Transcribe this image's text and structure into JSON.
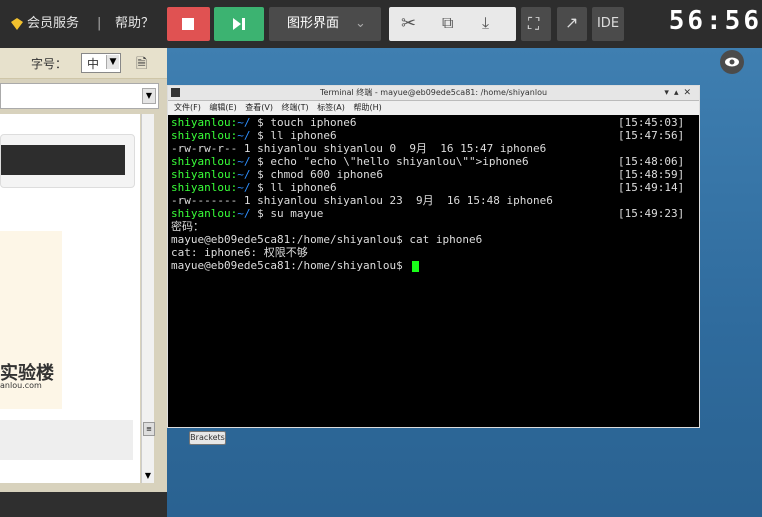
{
  "topbar": {
    "vip_label": "会员服务",
    "help_label": "帮助？",
    "desktop_label": "图形界面",
    "ide_label": "IDE",
    "timer": "56:56"
  },
  "left_panel": {
    "font_label": "字号：",
    "font_value": "中",
    "logo_text": "实验楼",
    "logo_sub": "anlou.com"
  },
  "terminal": {
    "title": "Terminal 终端 - mayue@eb09ede5ca81: /home/shiyanlou",
    "menu": [
      "文件(F)",
      "编辑(E)",
      "查看(V)",
      "终端(T)",
      "标签(A)",
      "帮助(H)"
    ],
    "lines": [
      {
        "prompt": "shiyanlou:",
        "path": "~/",
        "cmd": " $ touch iphone6",
        "time": "[15:45:03]"
      },
      {
        "prompt": "shiyanlou:",
        "path": "~/",
        "cmd": " $ ll iphone6",
        "time": "[15:47:56]"
      },
      {
        "text": "-rw-rw-r-- 1 shiyanlou shiyanlou 0  9月  16 15:47 iphone6"
      },
      {
        "prompt": "shiyanlou:",
        "path": "~/",
        "cmd": " $ echo \"echo \\\"hello shiyanlou\\\"\">iphone6",
        "time": "[15:48:06]"
      },
      {
        "prompt": "shiyanlou:",
        "path": "~/",
        "cmd": " $ chmod 600 iphone6",
        "time": "[15:48:59]"
      },
      {
        "prompt": "shiyanlou:",
        "path": "~/",
        "cmd": " $ ll iphone6",
        "time": "[15:49:14]"
      },
      {
        "text": "-rw------- 1 shiyanlou shiyanlou 23  9月  16 15:48 iphone6"
      },
      {
        "prompt": "shiyanlou:",
        "path": "~/",
        "cmd": " $ su mayue",
        "time": "[15:49:23]"
      },
      {
        "text": "密码："
      },
      {
        "text": "mayue@eb09ede5ca81:/home/shiyanlou$ cat iphone6"
      },
      {
        "text": "cat: iphone6: 权限不够"
      },
      {
        "text": "mayue@eb09ede5ca81:/home/shiyanlou$ "
      }
    ]
  },
  "desktop": {
    "brackets_label": "Brackets"
  }
}
